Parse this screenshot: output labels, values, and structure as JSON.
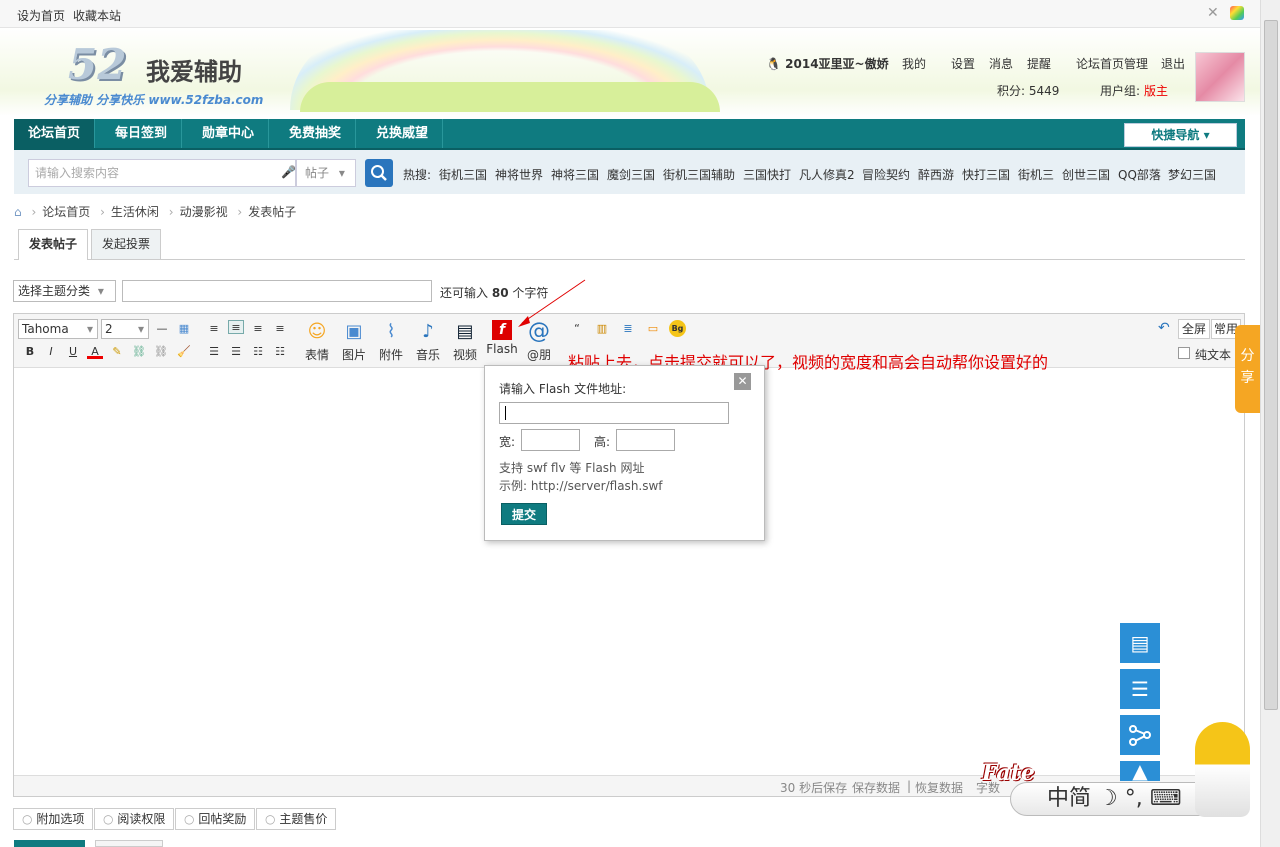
{
  "topbar": {
    "set_home": "设为首页",
    "bookmark": "收藏本站"
  },
  "logo": {
    "number": "52",
    "name": "我爱辅助",
    "slogan": "分享辅助 分享快乐 www.52fzba.com"
  },
  "user": {
    "name": "2014亚里亚~傲娇",
    "my": "我的",
    "settings": "设置",
    "messages": "消息",
    "reminders": "提醒",
    "admin": "论坛首页管理",
    "logout": "退出",
    "points": "积分: 5449",
    "group_label": "用户组:",
    "group_value": "版主"
  },
  "nav": {
    "items": [
      "论坛首页",
      "每日签到",
      "勋章中心",
      "免费抽奖",
      "兑换威望"
    ],
    "quick": "快捷导航"
  },
  "search": {
    "placeholder": "请输入搜索内容",
    "scope": "帖子",
    "hot_label": "热搜:",
    "hot": [
      "街机三国",
      "神将世界",
      "神将三国",
      "魔剑三国",
      "街机三国辅助",
      "三国快打",
      "凡人修真2",
      "冒险契约",
      "醉西游",
      "快打三国",
      "街机三",
      "创世三国",
      "QQ部落",
      "梦幻三国"
    ]
  },
  "breadcrumb": [
    "论坛首页",
    "生活休闲",
    "动漫影视",
    "发表帖子"
  ],
  "tabs": [
    "发表帖子",
    "发起投票"
  ],
  "post": {
    "category": "选择主题分类",
    "remaining_prefix": "还可输入",
    "remaining_count": "80",
    "remaining_suffix": "个字符"
  },
  "toolbar": {
    "font": "Tahoma",
    "size": "2",
    "buttons": [
      "表情",
      "图片",
      "附件",
      "音乐",
      "视频",
      "Flash",
      "@朋"
    ],
    "fullscreen": "全屏",
    "common": "常用",
    "plaintext": "纯文本"
  },
  "annotation": "粘贴上去，点击提交就可以了，视频的宽度和高会自动帮你设置好的",
  "flash_popup": {
    "title": "请输入 Flash 文件地址:",
    "width_label": "宽:",
    "height_label": "高:",
    "support": "支持 swf flv 等 Flash 网址",
    "example": "示例: http://server/flash.swf",
    "submit": "提交"
  },
  "editor_status": {
    "autosave": "30 秒后保存",
    "save": "保存数据",
    "restore": "恢复数据",
    "count": "字数"
  },
  "options": [
    "附加选项",
    "阅读权限",
    "回帖奖励",
    "主题售价"
  ],
  "share": "分享",
  "fate": {
    "logo": "Fate",
    "ime": "中简"
  },
  "colors": {
    "nav": "#0f7b80",
    "side": "#2b8fd6",
    "share": "#f5a623",
    "annotation": "#e00000"
  }
}
